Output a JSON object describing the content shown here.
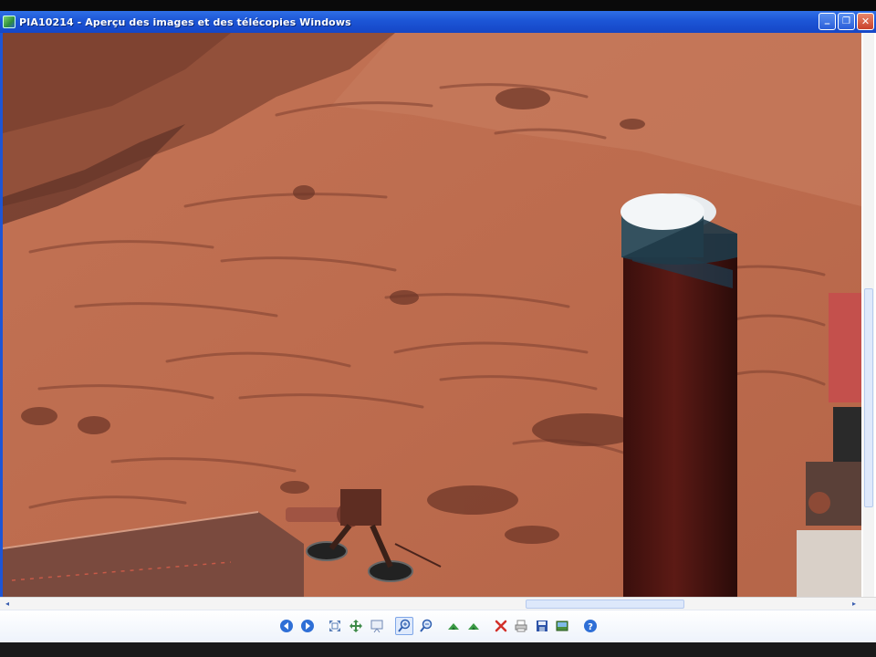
{
  "window": {
    "title": "PIA10214 - Aperçu des images et des télécopies Windows",
    "controls": {
      "minimize": "_",
      "maximize": "❐",
      "close": "✕"
    }
  },
  "image": {
    "description_icon": "mars-panorama-photo",
    "palette": {
      "sky": "#a6553c",
      "ground": "#c0704f",
      "rock": "#8a4a34",
      "shadow": "#5a2e22"
    }
  },
  "scrollbars": {
    "horizontal": {
      "left_arrow": "◂",
      "right_arrow": "▸",
      "position_fraction": 0.6
    },
    "vertical": {
      "position_fraction": 0.45
    }
  },
  "toolbar": {
    "buttons": [
      {
        "name": "previous-image-button",
        "icon": "previous-icon"
      },
      {
        "name": "next-image-button",
        "icon": "next-icon"
      },
      {
        "name": "best-fit-button",
        "icon": "best-fit-icon"
      },
      {
        "name": "actual-size-button",
        "icon": "actual-size-icon"
      },
      {
        "name": "slideshow-button",
        "icon": "slideshow-icon"
      },
      {
        "name": "zoom-in-button",
        "icon": "zoom-in-icon"
      },
      {
        "name": "zoom-out-button",
        "icon": "zoom-out-icon"
      },
      {
        "name": "rotate-clockwise-button",
        "icon": "rotate-clockwise-icon"
      },
      {
        "name": "rotate-counterclockwise-button",
        "icon": "rotate-counterclockwise-icon"
      },
      {
        "name": "delete-button",
        "icon": "delete-icon"
      },
      {
        "name": "print-button",
        "icon": "print-icon"
      },
      {
        "name": "save-button",
        "icon": "save-icon"
      },
      {
        "name": "edit-button",
        "icon": "edit-icon"
      },
      {
        "name": "help-button",
        "icon": "help-icon"
      }
    ]
  }
}
